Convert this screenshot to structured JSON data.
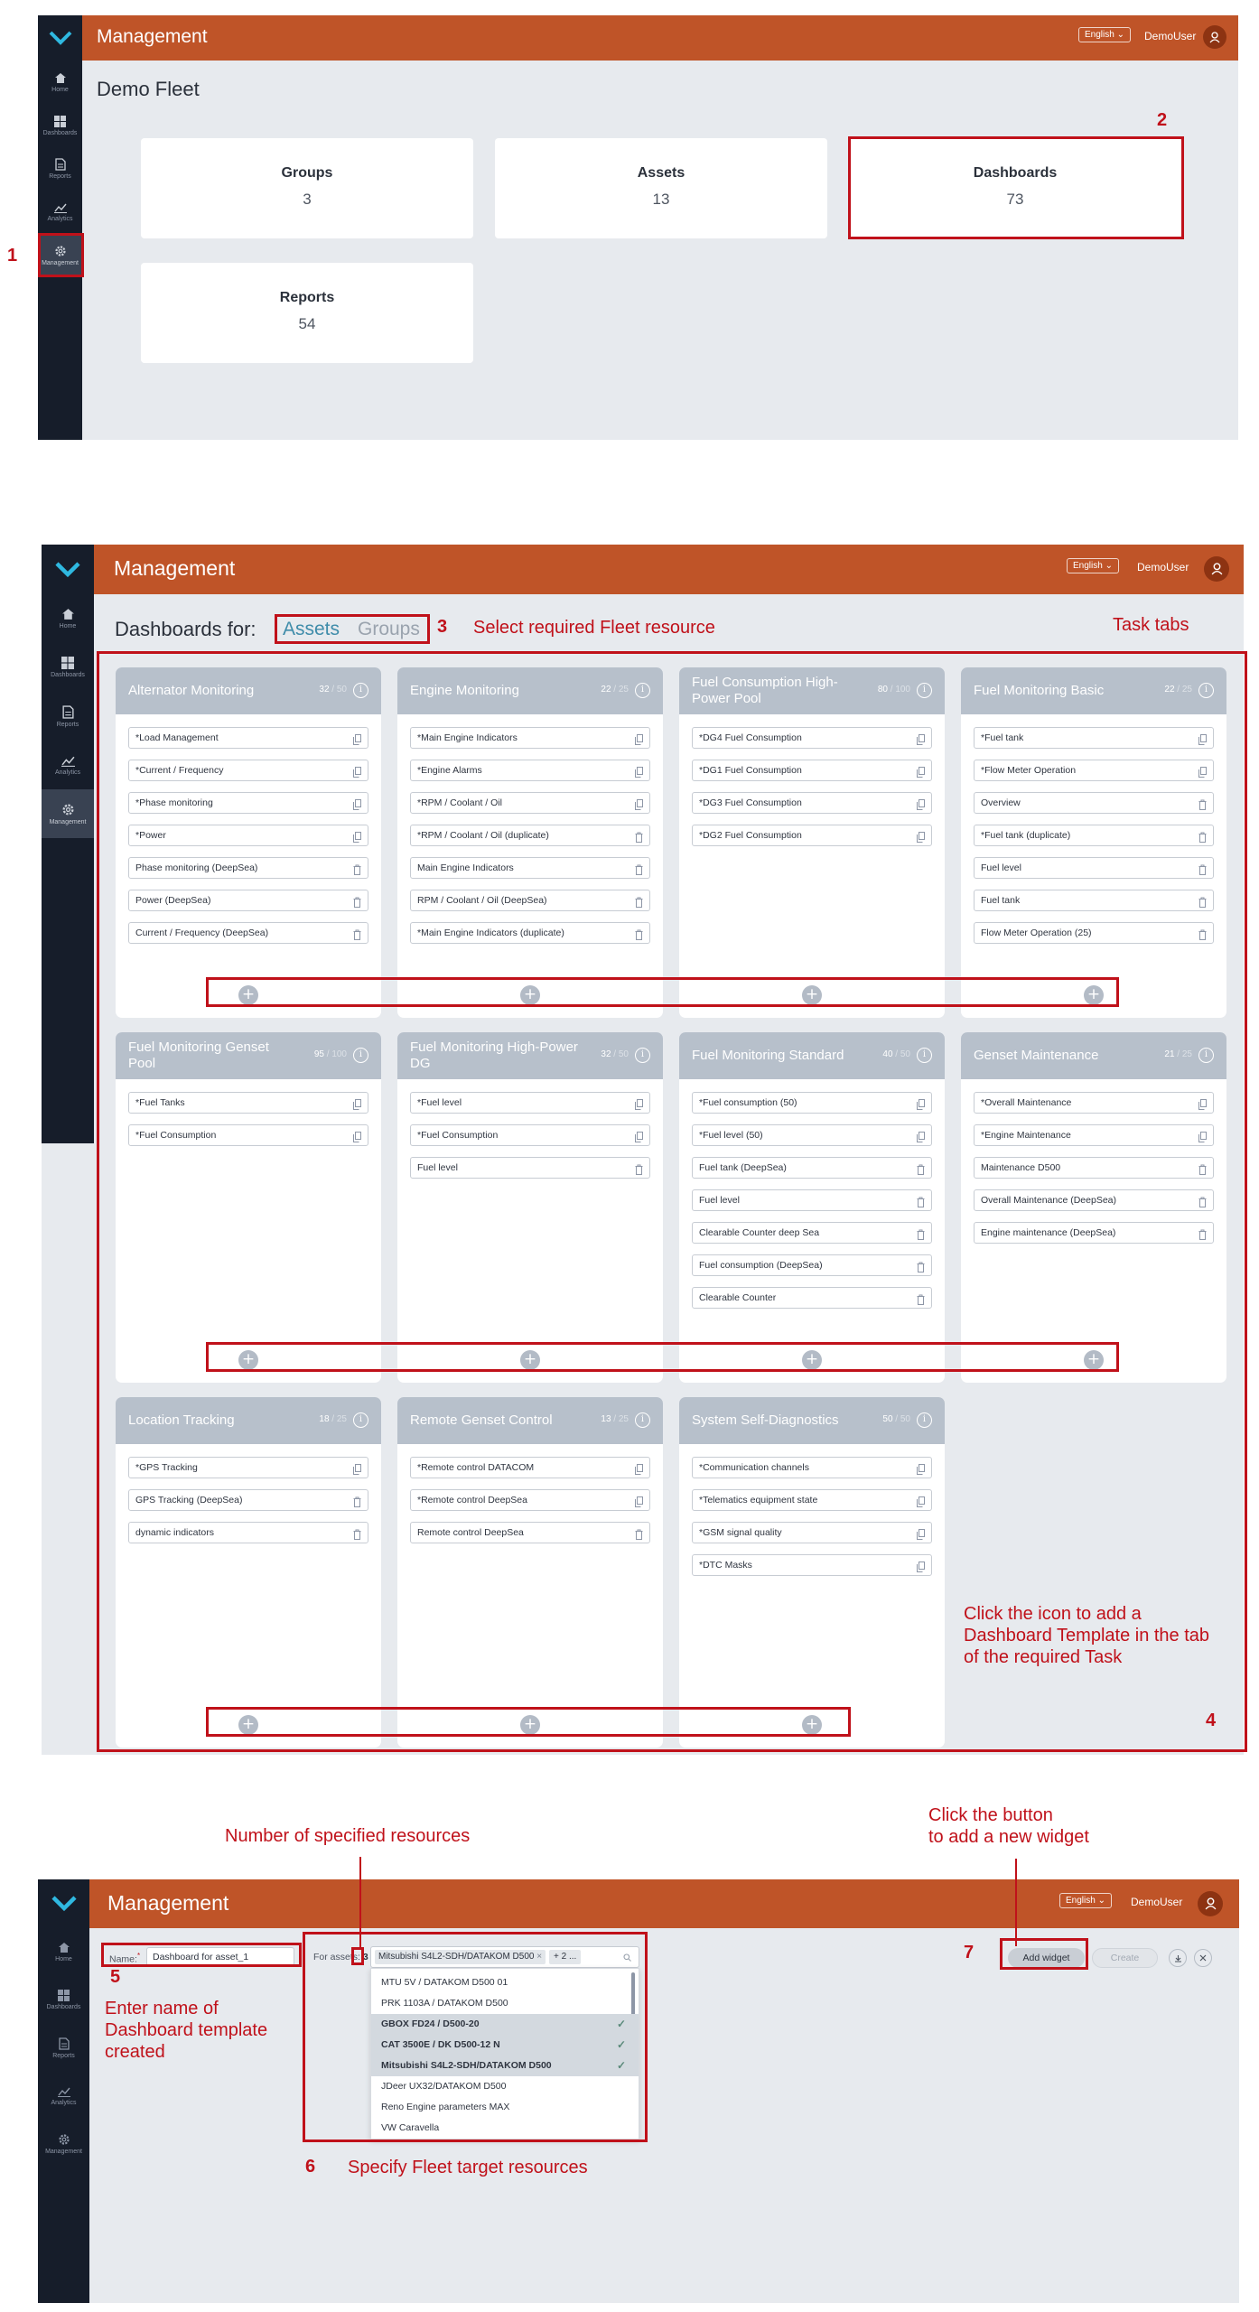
{
  "section1": {
    "app_title": "Management",
    "language": "English",
    "user": "DemoUser",
    "page_title": "Demo Fleet",
    "nav": [
      "Home",
      "Dashboards",
      "Reports",
      "Analytics",
      "Management"
    ],
    "cards": [
      {
        "label": "Groups",
        "value": "3"
      },
      {
        "label": "Assets",
        "value": "13"
      },
      {
        "label": "Dashboards",
        "value": "73"
      },
      {
        "label": "Reports",
        "value": "54"
      }
    ],
    "annotations": {
      "n1": "1",
      "n2": "2"
    }
  },
  "section2": {
    "app_title": "Management",
    "language": "English",
    "user": "DemoUser",
    "nav": [
      "Home",
      "Dashboards",
      "Reports",
      "Analytics",
      "Management"
    ],
    "dashboards_for": "Dashboards for:",
    "tab_assets": "Assets",
    "tab_groups": "Groups",
    "annotations": {
      "n3": "3",
      "select_resource": "Select required Fleet resource",
      "task_tabs": "Task tabs",
      "click_icon": "Click the icon to add a Dashboard Template in the tab of the required Task",
      "n4": "4"
    },
    "tasks": [
      {
        "title": "Alternator Monitoring",
        "count": "32",
        "max": "50",
        "items": [
          {
            "name": "*Load Management",
            "action": "copy"
          },
          {
            "name": "*Current / Frequency",
            "action": "copy"
          },
          {
            "name": "*Phase monitoring",
            "action": "copy"
          },
          {
            "name": "*Power",
            "action": "copy"
          },
          {
            "name": "Phase monitoring (DeepSea)",
            "action": "delete"
          },
          {
            "name": "Power (DeepSea)",
            "action": "delete"
          },
          {
            "name": "Current / Frequency (DeepSea)",
            "action": "delete"
          }
        ]
      },
      {
        "title": "Engine Monitoring",
        "count": "22",
        "max": "25",
        "items": [
          {
            "name": "*Main Engine Indicators",
            "action": "copy"
          },
          {
            "name": "*Engine Alarms",
            "action": "copy"
          },
          {
            "name": "*RPM / Coolant / Oil",
            "action": "copy"
          },
          {
            "name": "*RPM / Coolant / Oil (duplicate)",
            "action": "delete"
          },
          {
            "name": "Main Engine Indicators",
            "action": "delete"
          },
          {
            "name": "RPM / Coolant / Oil (DeepSea)",
            "action": "delete"
          },
          {
            "name": "*Main Engine Indicators (duplicate)",
            "action": "delete"
          }
        ]
      },
      {
        "title": "Fuel Consumption High-Power Pool",
        "count": "80",
        "max": "100",
        "items": [
          {
            "name": "*DG4 Fuel Consumption",
            "action": "copy"
          },
          {
            "name": "*DG1 Fuel Consumption",
            "action": "copy"
          },
          {
            "name": "*DG3 Fuel Consumption",
            "action": "copy"
          },
          {
            "name": "*DG2 Fuel Consumption",
            "action": "copy"
          }
        ]
      },
      {
        "title": "Fuel Monitoring Basic",
        "count": "22",
        "max": "25",
        "items": [
          {
            "name": "*Fuel tank",
            "action": "copy"
          },
          {
            "name": "*Flow Meter Operation",
            "action": "copy"
          },
          {
            "name": "Overview",
            "action": "delete"
          },
          {
            "name": "*Fuel tank (duplicate)",
            "action": "delete"
          },
          {
            "name": "Fuel level",
            "action": "delete"
          },
          {
            "name": "Fuel tank",
            "action": "delete"
          },
          {
            "name": "Flow Meter Operation (25)",
            "action": "delete"
          }
        ]
      },
      {
        "title": "Fuel Monitoring Genset Pool",
        "count": "95",
        "max": "100",
        "items": [
          {
            "name": "*Fuel Tanks",
            "action": "copy"
          },
          {
            "name": "*Fuel Consumption",
            "action": "copy"
          }
        ]
      },
      {
        "title": "Fuel Monitoring High-Power DG",
        "count": "32",
        "max": "50",
        "items": [
          {
            "name": "*Fuel level",
            "action": "copy"
          },
          {
            "name": "*Fuel Consumption",
            "action": "copy"
          },
          {
            "name": "Fuel level",
            "action": "delete"
          }
        ]
      },
      {
        "title": "Fuel Monitoring Standard",
        "count": "40",
        "max": "50",
        "items": [
          {
            "name": "*Fuel consumption (50)",
            "action": "copy"
          },
          {
            "name": "*Fuel level (50)",
            "action": "copy"
          },
          {
            "name": "Fuel tank (DeepSea)",
            "action": "delete"
          },
          {
            "name": "Fuel level",
            "action": "delete"
          },
          {
            "name": "Clearable Counter deep Sea",
            "action": "delete"
          },
          {
            "name": "Fuel consumption (DeepSea)",
            "action": "delete"
          },
          {
            "name": "Clearable Counter",
            "action": "delete"
          }
        ]
      },
      {
        "title": "Genset Maintenance",
        "count": "21",
        "max": "25",
        "items": [
          {
            "name": "*Overall Maintenance",
            "action": "copy"
          },
          {
            "name": "*Engine Maintenance",
            "action": "copy"
          },
          {
            "name": "Maintenance D500",
            "action": "delete"
          },
          {
            "name": "Overall Maintenance (DeepSea)",
            "action": "delete"
          },
          {
            "name": "Engine maintenance (DeepSea)",
            "action": "delete"
          }
        ]
      },
      {
        "title": "Location Tracking",
        "count": "18",
        "max": "25",
        "items": [
          {
            "name": "*GPS Tracking",
            "action": "copy"
          },
          {
            "name": "GPS Tracking (DeepSea)",
            "action": "delete"
          },
          {
            "name": "dynamic indicators",
            "action": "delete"
          }
        ]
      },
      {
        "title": "Remote Genset Control",
        "count": "13",
        "max": "25",
        "items": [
          {
            "name": "*Remote control DATACOM",
            "action": "copy"
          },
          {
            "name": "*Remote control DeepSea",
            "action": "copy"
          },
          {
            "name": "Remote control DeepSea",
            "action": "delete"
          }
        ]
      },
      {
        "title": "System Self-Diagnostics",
        "count": "50",
        "max": "50",
        "items": [
          {
            "name": "*Communication channels",
            "action": "copy"
          },
          {
            "name": "*Telematics equipment state",
            "action": "copy"
          },
          {
            "name": "*GSM signal quality",
            "action": "copy"
          },
          {
            "name": "*DTC Masks",
            "action": "copy"
          }
        ]
      }
    ]
  },
  "section3": {
    "app_title": "Management",
    "language": "English",
    "user": "DemoUser",
    "nav": [
      "Home",
      "Dashboards",
      "Reports",
      "Analytics",
      "Management"
    ],
    "name_label": "Name:",
    "name_required": "*",
    "name_value": "Dashboard for asset_1",
    "for_assets_label": "For assets:",
    "for_assets_count": "3",
    "chip": "Mitsubishi S4L2-SDH/DATAKOM D500",
    "chip_more": "+ 2 ...",
    "add_widget": "Add widget",
    "create": "Create",
    "dropdown": [
      {
        "label": "MTU 5V / DATAKOM D500 01",
        "selected": false
      },
      {
        "label": "PRK 1103A / DATAKOM D500",
        "selected": false
      },
      {
        "label": "GBOX FD24 / D500-20",
        "selected": true
      },
      {
        "label": "CAT 3500E / DK D500-12 N",
        "selected": true
      },
      {
        "label": "Mitsubishi S4L2-SDH/DATAKOM D500",
        "selected": true
      },
      {
        "label": "JDeer UX32/DATAKOM D500",
        "selected": false
      },
      {
        "label": "Reno Engine parameters MAX",
        "selected": false
      },
      {
        "label": "VW Caravella",
        "selected": false
      }
    ],
    "annotations": {
      "num_resources": "Number of specified resources",
      "click_button_1": "Click the button",
      "click_button_2": "to  add a new widget",
      "n7": "7",
      "n5": "5",
      "enter_name": "Enter name of Dashboard template created",
      "n6": "6",
      "specify": "Specify Fleet target resources"
    }
  },
  "colors": {
    "header": "#bf5428",
    "sidebar": "#161d2a",
    "content_bg": "#e7eaee",
    "task_header": "#b7c0cb",
    "annotation_red": "#c0111a",
    "link_teal": "#3f8caa"
  },
  "icons": [
    "logo-chevron-icon",
    "home-icon",
    "dashboards-icon",
    "reports-icon",
    "analytics-icon",
    "gear-icon",
    "user-icon",
    "info-icon",
    "copy-icon",
    "trash-icon",
    "plus-icon",
    "search-icon",
    "download-icon",
    "close-icon",
    "check-icon",
    "chevron-down-icon"
  ]
}
